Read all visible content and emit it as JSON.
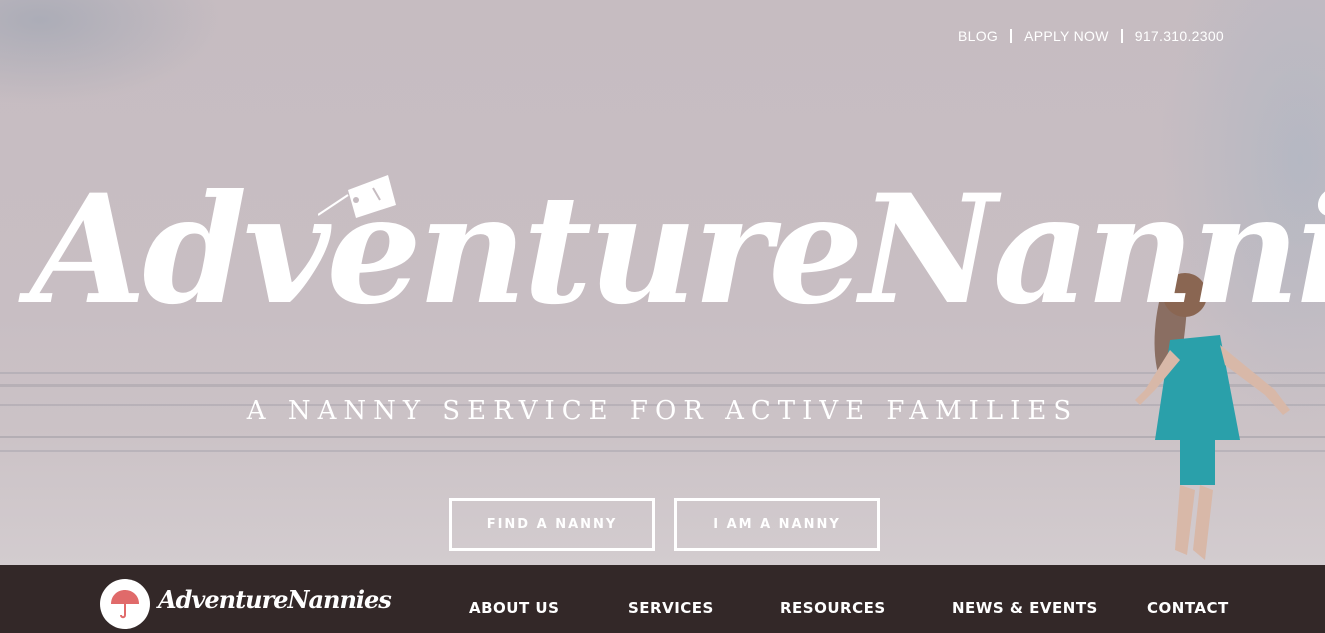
{
  "top_links": {
    "blog": "BLOG",
    "apply": "APPLY NOW",
    "phone": "917.310.2300"
  },
  "hero": {
    "logo_text": "AdventureNannies",
    "tagline": "A NANNY SERVICE FOR ACTIVE FAMILIES",
    "cta_find": "FIND A NANNY",
    "cta_nanny": "I AM A NANNY"
  },
  "nav": {
    "logo_text": "AdventureNannies",
    "items": [
      "ABOUT US",
      "SERVICES",
      "RESOURCES",
      "NEWS & EVENTS",
      "CONTACT"
    ]
  },
  "colors": {
    "nav_bg": "#332828",
    "hero_tint": "#c9bfc4",
    "umbrella_red": "#e06a6a",
    "dress": "#2aa0aa"
  },
  "icons": {
    "logo_icon": "umbrella-icon",
    "tag_icon": "luggage-tag-icon"
  }
}
